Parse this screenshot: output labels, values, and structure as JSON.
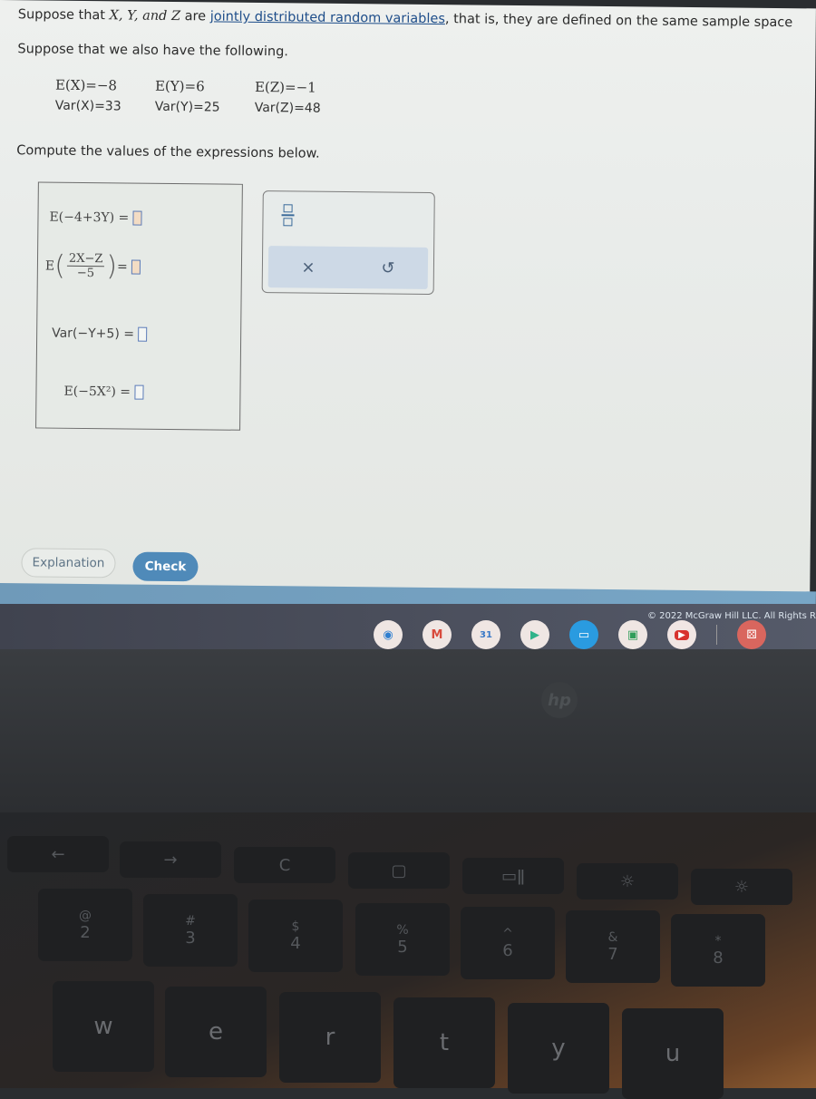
{
  "problem": {
    "intro_prefix": "Suppose that ",
    "vars": "X, Y, and Z",
    "intro_mid": " are ",
    "link_text": "jointly distributed random variables",
    "intro_suffix": ", that is, they are defined on the same sample space",
    "intro2": "Suppose that we also have the following.",
    "givens": [
      {
        "label": "E(X)=−8",
        "type": "e"
      },
      {
        "label": "E(Y)=6",
        "type": "e"
      },
      {
        "label": "E(Z)=−1",
        "type": "e"
      },
      {
        "label": "Var(X)=33",
        "type": "v"
      },
      {
        "label": "Var(Y)=25",
        "type": "v"
      },
      {
        "label": "Var(Z)=48",
        "type": "v"
      }
    ],
    "compute_text": "Compute the values of the expressions below."
  },
  "questions": [
    {
      "expr": "E(−4+3Y) =",
      "answer": ""
    },
    {
      "prefix": "E",
      "numerator": "2X−Z",
      "denominator": "−5",
      "eq": "=",
      "answer": ""
    },
    {
      "expr": "Var(−Y+5) =",
      "answer": ""
    },
    {
      "expr": "E(−5X²) =",
      "answer": ""
    }
  ],
  "toolbox": {
    "fraction_tool": "fraction-icon",
    "clear_symbol": "×",
    "undo_symbol": "↺"
  },
  "buttons": {
    "explanation": "Explanation",
    "check": "Check"
  },
  "footer": {
    "copyright": "© 2022 McGraw Hill LLC. All Rights R"
  },
  "shelf": {
    "apps": [
      {
        "name": "chrome",
        "glyph": "◉",
        "color": "#2f7fd0"
      },
      {
        "name": "gmail",
        "glyph": "M",
        "color": "#d84b3d"
      },
      {
        "name": "calendar",
        "glyph": "31",
        "color": "#3a79c7"
      },
      {
        "name": "play-store",
        "glyph": "▶",
        "color": "#2fb38a"
      },
      {
        "name": "messages",
        "glyph": "▭",
        "color": "#ffffff"
      },
      {
        "name": "meet",
        "glyph": "▣",
        "color": "#2f9d5a"
      },
      {
        "name": "youtube",
        "glyph": "▶",
        "color": "#ffffff"
      },
      {
        "name": "app-launcher",
        "glyph": "⚄",
        "color": "#ffffff"
      }
    ]
  },
  "device": {
    "logo": "hp"
  },
  "keyboard": {
    "fn_row": [
      "←",
      "→",
      "C",
      "▢",
      "▭ǁ",
      "☼",
      "☼"
    ],
    "num_row": [
      {
        "top": "@",
        "bottom": "2"
      },
      {
        "top": "#",
        "bottom": "3"
      },
      {
        "top": "$",
        "bottom": "4"
      },
      {
        "top": "%",
        "bottom": "5"
      },
      {
        "top": "^",
        "bottom": "6"
      },
      {
        "top": "&",
        "bottom": "7"
      },
      {
        "top": "*",
        "bottom": "8"
      }
    ],
    "letter_row": [
      "w",
      "e",
      "r",
      "t",
      "y",
      "u"
    ]
  }
}
